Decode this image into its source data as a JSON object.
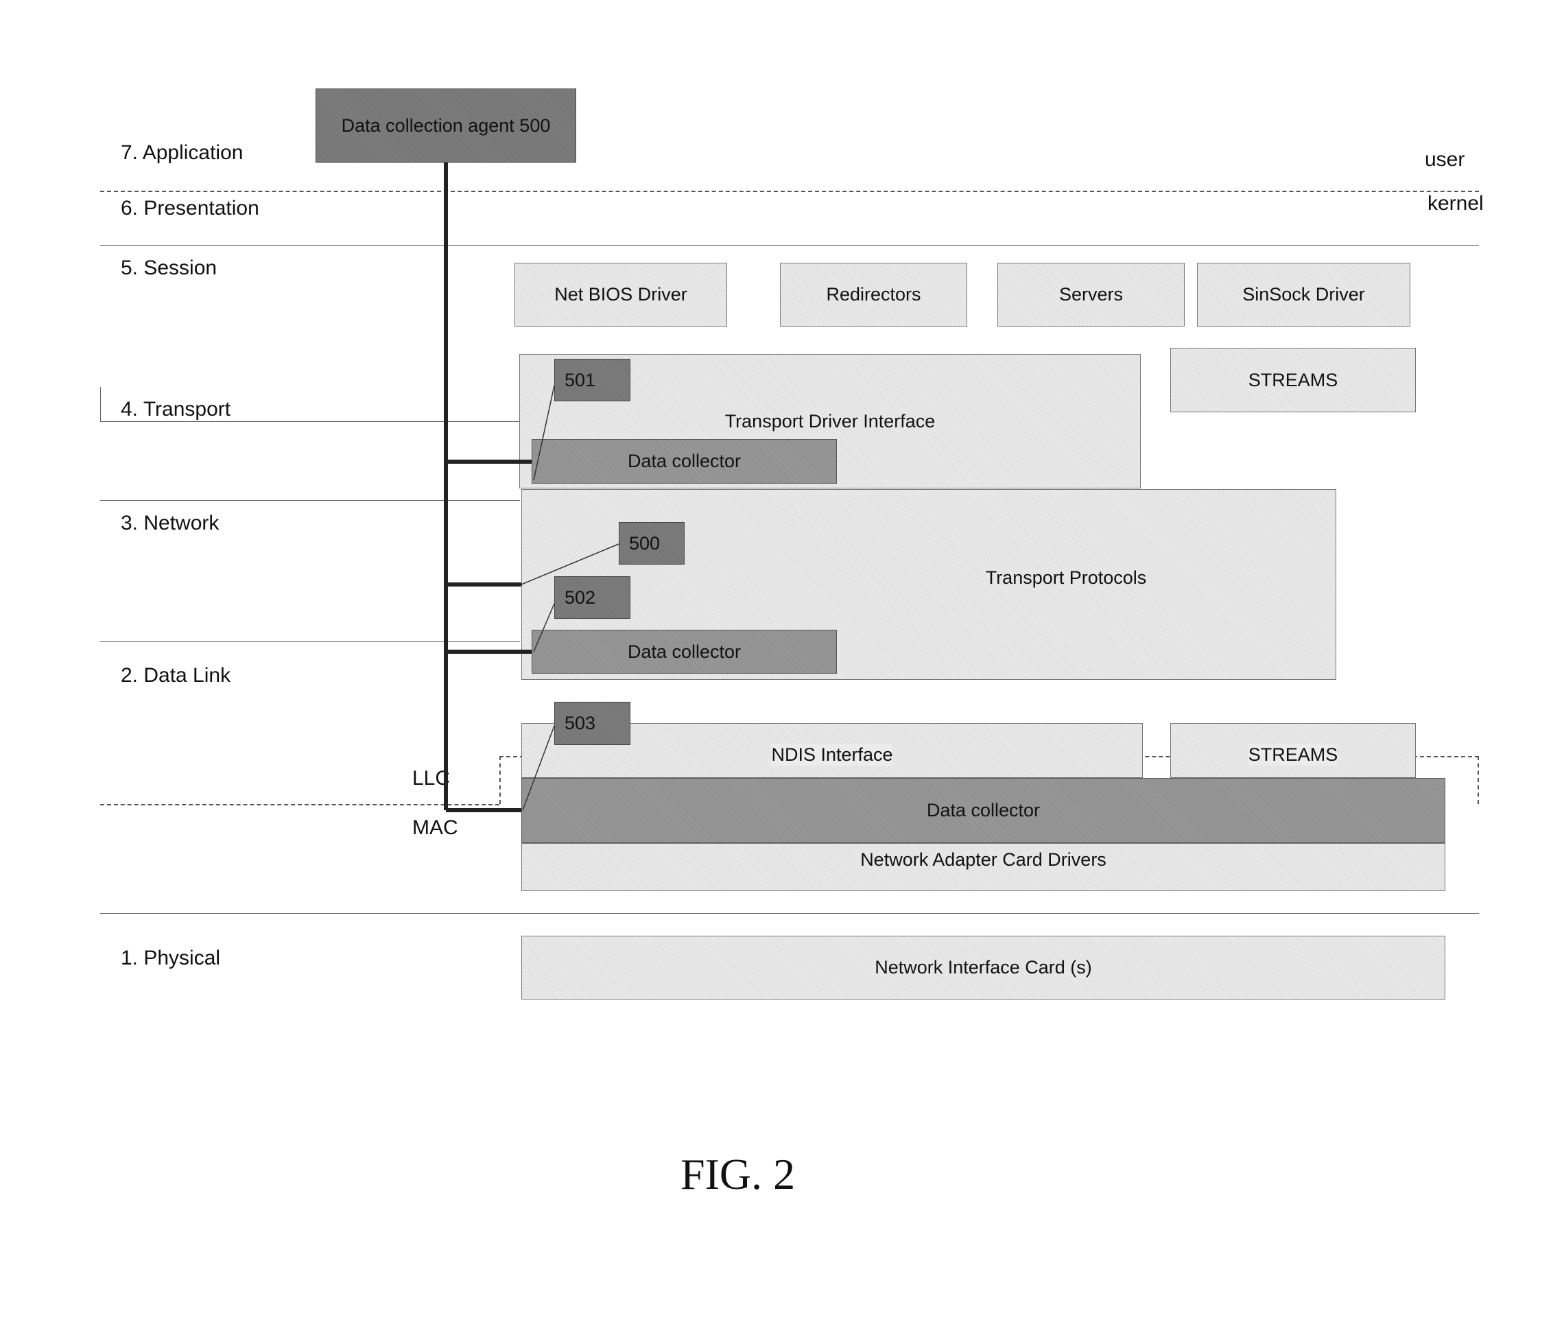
{
  "figure": {
    "caption": "FIG. 2",
    "mode_labels": {
      "user": "user",
      "kernel": "kernel"
    },
    "layers": [
      {
        "id": "application",
        "label": "7. Application"
      },
      {
        "id": "presentation",
        "label": "6. Presentation"
      },
      {
        "id": "session",
        "label": "5. Session"
      },
      {
        "id": "transport",
        "label": "4. Transport"
      },
      {
        "id": "network",
        "label": "3. Network"
      },
      {
        "id": "datalink",
        "label": "2. Data Link"
      },
      {
        "id": "physical",
        "label": "1. Physical"
      }
    ],
    "sublayers": {
      "llc": "LLC",
      "mac": "MAC"
    },
    "agent": {
      "label": "Data collection agent 500"
    },
    "session_boxes": [
      {
        "label": "Net BIOS Driver"
      },
      {
        "label": "Redirectors"
      },
      {
        "label": "Servers"
      },
      {
        "label": "SinSock Driver"
      }
    ],
    "transport": {
      "tdi": "Transport Driver Interface",
      "streams": "STREAMS",
      "ref": "501",
      "collector": "Data collector"
    },
    "network": {
      "protocols": "Transport Protocols",
      "ref_agent": "500",
      "ref": "502",
      "collector": "Data collector"
    },
    "datalink": {
      "ndis": "NDIS Interface",
      "streams": "STREAMS",
      "ref": "503",
      "collector": "Data collector",
      "drivers": "Network Adapter Card Drivers"
    },
    "physical": {
      "nic": "Network Interface Card (s)"
    }
  }
}
